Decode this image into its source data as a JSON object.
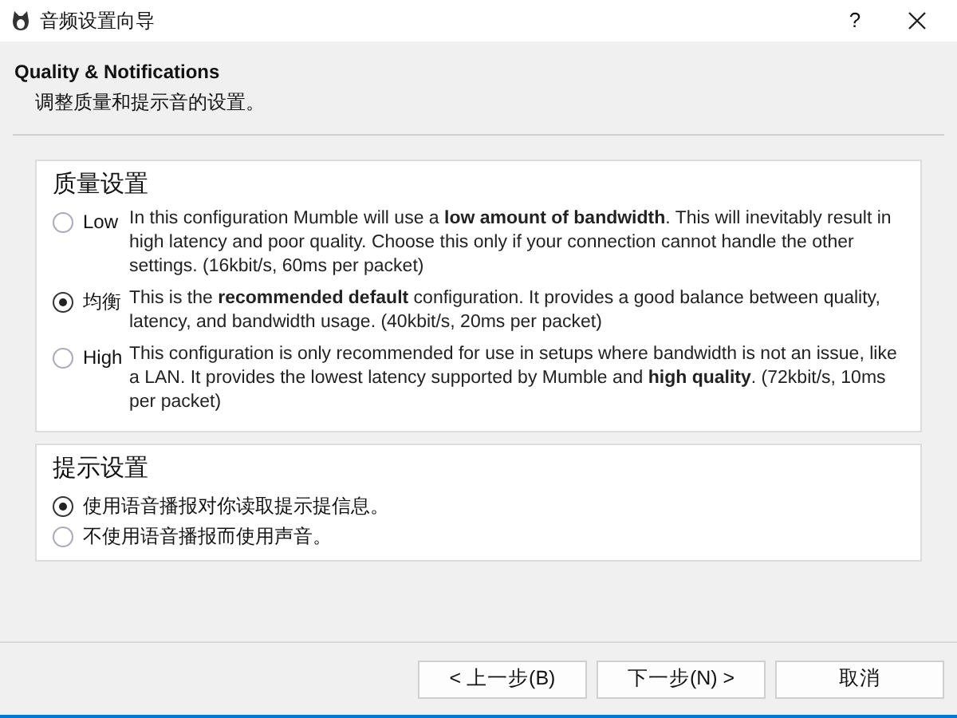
{
  "window": {
    "title": "音频设置向导",
    "help": "?"
  },
  "header": {
    "title": "Quality & Notifications",
    "subtitle": "调整质量和提示音的设置。"
  },
  "quality_group": {
    "title": "质量设置",
    "options": [
      {
        "label": "Low",
        "selected": false,
        "description": "In this configuration Mumble will use a **low amount of bandwidth**. This will inevitably result in high latency and poor quality. Choose this only if your connection cannot handle the other settings. (16kbit/s, 60ms per packet)"
      },
      {
        "label": "均衡",
        "selected": true,
        "description": "This is the **recommended default** configuration. It provides a good balance between quality, latency, and bandwidth usage. (40kbit/s, 20ms per packet)"
      },
      {
        "label": "High",
        "selected": false,
        "description": "This configuration is only recommended for use in setups where bandwidth is not an issue, like a LAN. It provides the lowest latency supported by Mumble and **high quality**. (72kbit/s, 10ms per packet)"
      }
    ]
  },
  "notification_group": {
    "title": "提示设置",
    "options": [
      {
        "label": "使用语音播报对你读取提示提信息。",
        "selected": true
      },
      {
        "label": "不使用语音播报而使用声音。",
        "selected": false
      }
    ]
  },
  "buttons": [
    {
      "label": "< 上一步(B)"
    },
    {
      "label": "下一步(N) >"
    },
    {
      "label": "取消"
    }
  ]
}
